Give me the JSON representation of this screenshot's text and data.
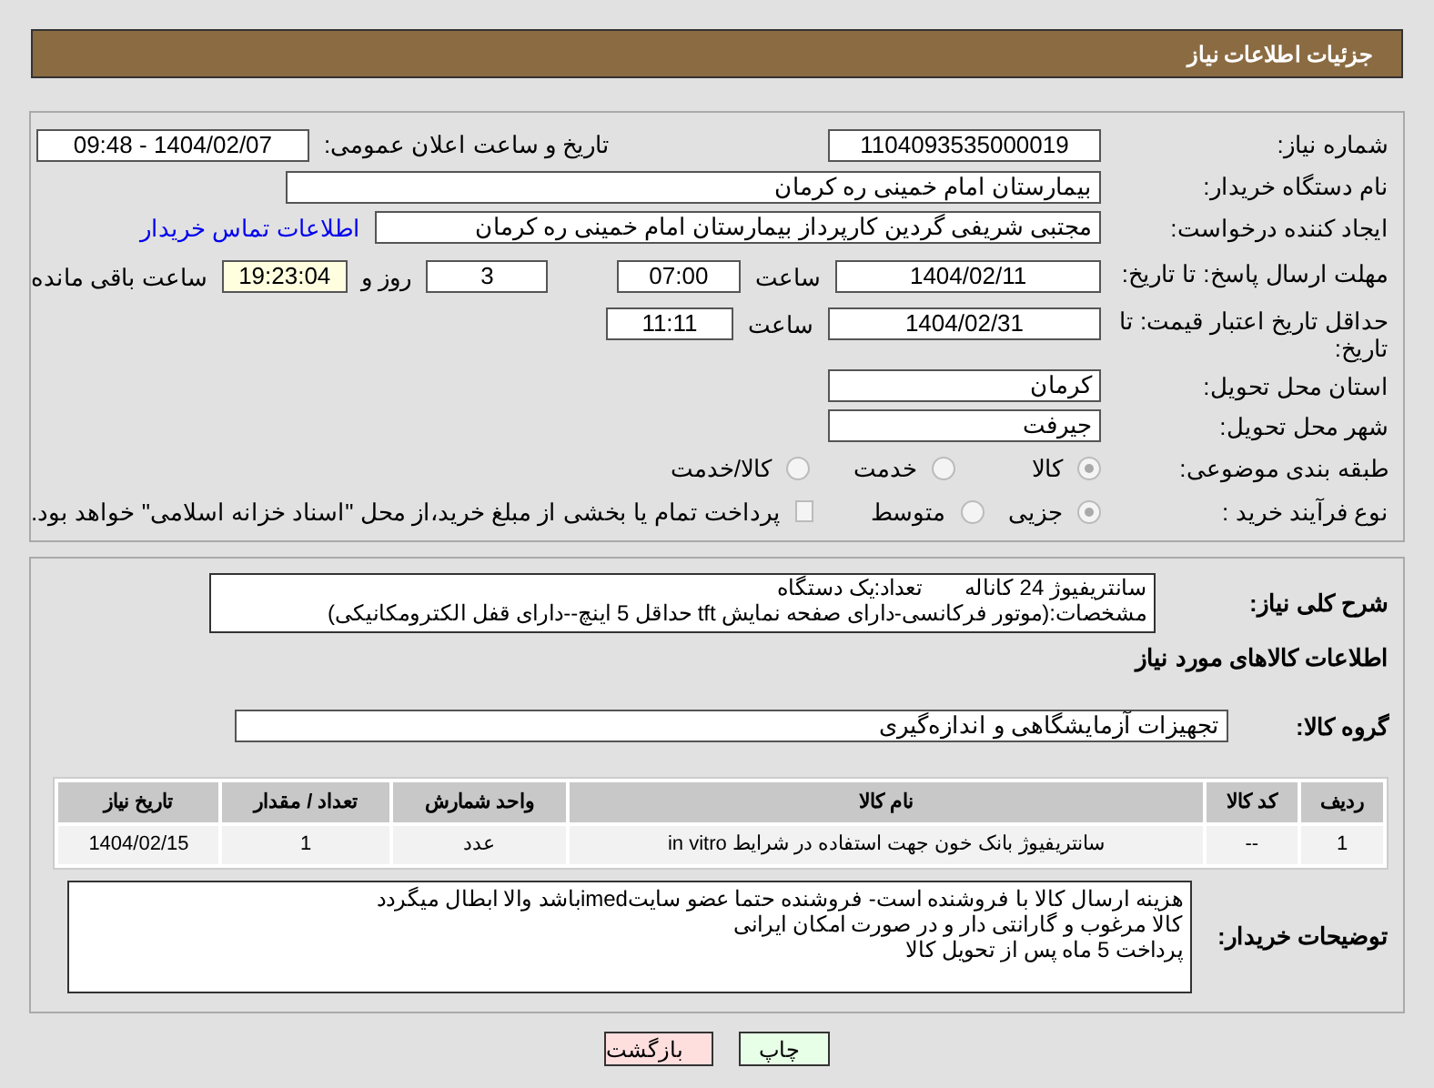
{
  "header": {
    "title": "جزئیات اطلاعات نیاز"
  },
  "need_number": {
    "label": "شماره نیاز:",
    "value": "1104093535000019"
  },
  "announce": {
    "label": "تاریخ و ساعت اعلان عمومی:",
    "value": "1404/02/07 - 09:48"
  },
  "buyer": {
    "label": "نام دستگاه خریدار:",
    "value": "بیمارستان امام خمینی  ره  کرمان"
  },
  "requester": {
    "label": "ایجاد کننده درخواست:",
    "value": "مجتبی شریفی گردین کارپرداز بیمارستان امام خمینی  ره  کرمان",
    "link": "اطلاعات تماس خریدار"
  },
  "deadline": {
    "label": "مهلت ارسال پاسخ: تا تاریخ:",
    "date": "1404/02/11",
    "time_label": "ساعت",
    "time": "07:00",
    "days": "3",
    "days_label": "روز و",
    "remaining": "19:23:04",
    "remaining_label": "ساعت باقی مانده"
  },
  "validity": {
    "label": "حداقل تاریخ اعتبار قیمت: تا تاریخ:",
    "date": "1404/02/31",
    "time_label": "ساعت",
    "time": "11:11"
  },
  "province": {
    "label": "استان محل تحویل:",
    "value": "کرمان"
  },
  "city": {
    "label": "شهر محل تحویل:",
    "value": "جیرفت"
  },
  "category": {
    "label": "طبقه بندی موضوعی:",
    "options": [
      {
        "label": "کالا",
        "selected": true
      },
      {
        "label": "خدمت",
        "selected": false
      },
      {
        "label": "کالا/خدمت",
        "selected": false
      }
    ]
  },
  "purchase_type": {
    "label": "نوع فرآیند خرید :",
    "options": [
      {
        "label": "جزیی",
        "selected": true
      },
      {
        "label": "متوسط",
        "selected": false
      }
    ],
    "payment": {
      "checked": false,
      "label": "پرداخت تمام یا بخشی از مبلغ خرید،از محل \"اسناد خزانه اسلامی\" خواهد بود."
    }
  },
  "description": {
    "label": "شرح کلی نیاز:",
    "lines": [
      "سانتریفیوژ 24 کاناله       تعداد:یک دستگاه",
      "مشخصات:(موتور فرکانسی-دارای صفحه نمایش tft حداقل 5 اینچ--دارای قفل الکترومکانیکی)"
    ]
  },
  "goods_heading": "اطلاعات کالاهای مورد نیاز",
  "goods_group": {
    "label": "گروه کالا:",
    "value": "تجهیزات آزمایشگاهی و اندازه‌گیری"
  },
  "table": {
    "columns": [
      "ردیف",
      "کد کالا",
      "نام کالا",
      "واحد شمارش",
      "تعداد / مقدار",
      "تاریخ نیاز"
    ],
    "rows": [
      [
        "1",
        "--",
        "سانتریفیوژ بانک خون جهت استفاده در شرایط in vitro",
        "عدد",
        "1",
        "1404/02/15"
      ]
    ]
  },
  "buyer_notes": {
    "label": "توضیحات خریدار:",
    "lines": [
      "هزینه ارسال کالا با فروشنده است- فروشنده حتما عضو سایتimedباشد والا ابطال میگردد",
      "کالا مرغوب و گارانتی دار و در صورت امکان ایرانی",
      "پرداخت 5 ماه پس از تحویل کالا"
    ]
  },
  "buttons": [
    {
      "label": "چاپ",
      "kind": "print"
    },
    {
      "label": "بازگشت",
      "kind": "back"
    }
  ]
}
